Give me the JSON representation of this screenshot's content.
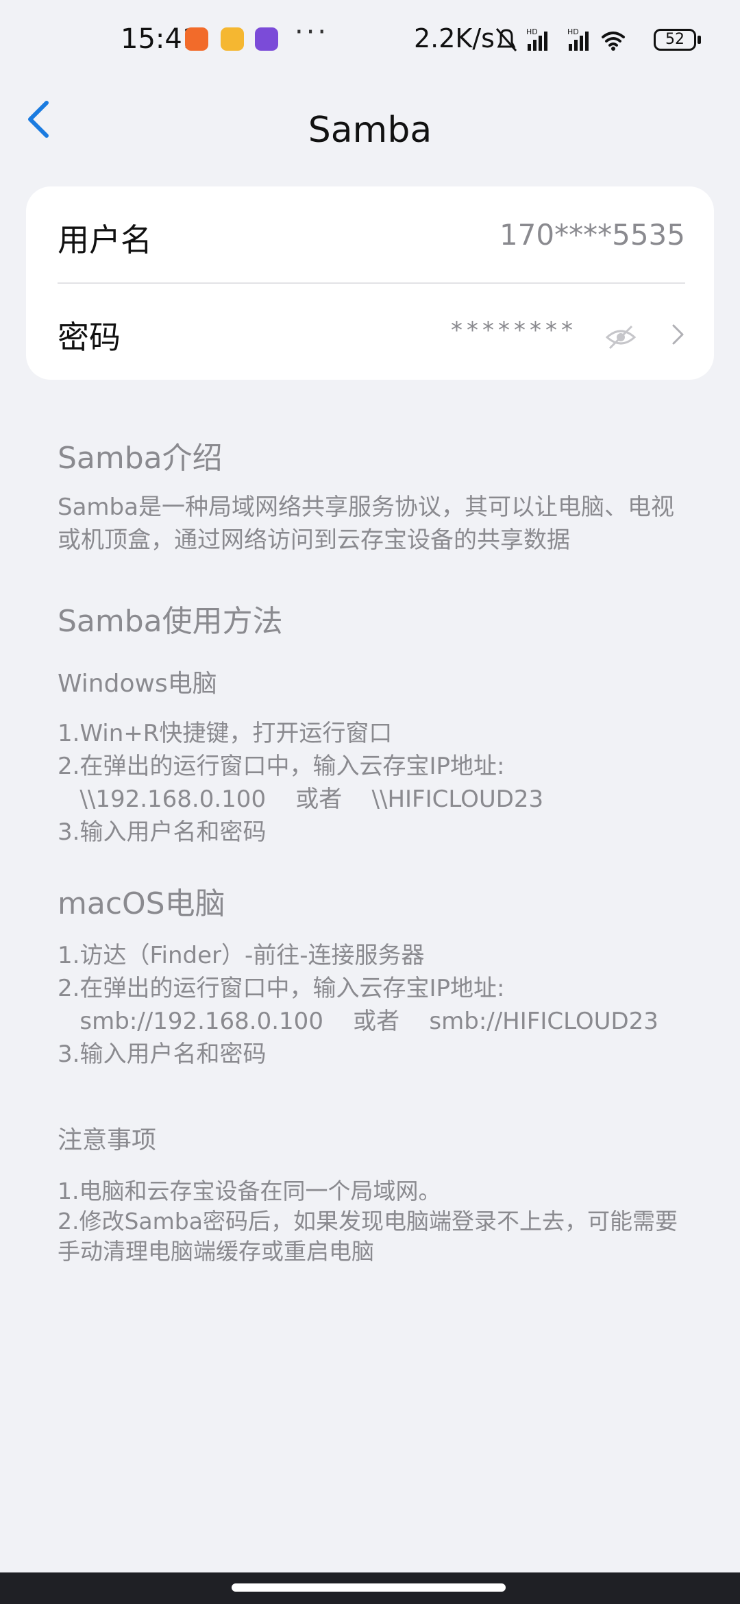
{
  "status_bar": {
    "time": "15:41",
    "app_icons": [
      {
        "name": "app-icon-orange",
        "color": "#f26b2a"
      },
      {
        "name": "app-icon-yellow",
        "color": "#f5b731"
      },
      {
        "name": "app-icon-purple",
        "color": "#7b4bd8"
      }
    ],
    "more": "···",
    "network_speed": "2.2K/s",
    "battery": "52"
  },
  "nav": {
    "back_icon": "chevron-left-icon",
    "title": "Samba"
  },
  "account_card": {
    "username_label": "用户名",
    "username_value": "170****5535",
    "password_label": "密码",
    "password_mask": "********",
    "eye_icon": "eye-off-icon",
    "chevron_icon": "chevron-right-icon"
  },
  "intro": {
    "heading": "Samba介绍",
    "body": "Samba是一种局域网络共享服务协议，其可以让电脑、电视或机顶盒，通过网络访问到云存宝设备的共享数据"
  },
  "usage": {
    "heading": "Samba使用方法",
    "windows": {
      "heading": "Windows电脑",
      "steps": [
        "1.Win+R快捷键，打开运行窗口",
        "2.在弹出的运行窗口中，输入云存宝IP地址:",
        "   \\\\192.168.0.100    或者    \\\\HIFICLOUD23",
        "3.输入用户名和密码"
      ]
    },
    "mac": {
      "heading": "macOS电脑",
      "steps": [
        "1.访达（Finder）-前往-连接服务器",
        "2.在弹出的运行窗口中，输入云存宝IP地址:",
        "   smb://192.168.0.100    或者    smb://HIFICLOUD23",
        "3.输入用户名和密码"
      ]
    }
  },
  "notes": {
    "heading": "注意事项",
    "items": [
      "1.电脑和云存宝设备在同一个局域网。",
      "2.修改Samba密码后，如果发现电脑端登录不上去，可能需要手动清理电脑端缓存或重启电脑"
    ]
  },
  "colors": {
    "accent": "#1a7be0",
    "background": "#f1f2f6",
    "card": "#ffffff",
    "secondary_text": "#8a8a8f"
  }
}
